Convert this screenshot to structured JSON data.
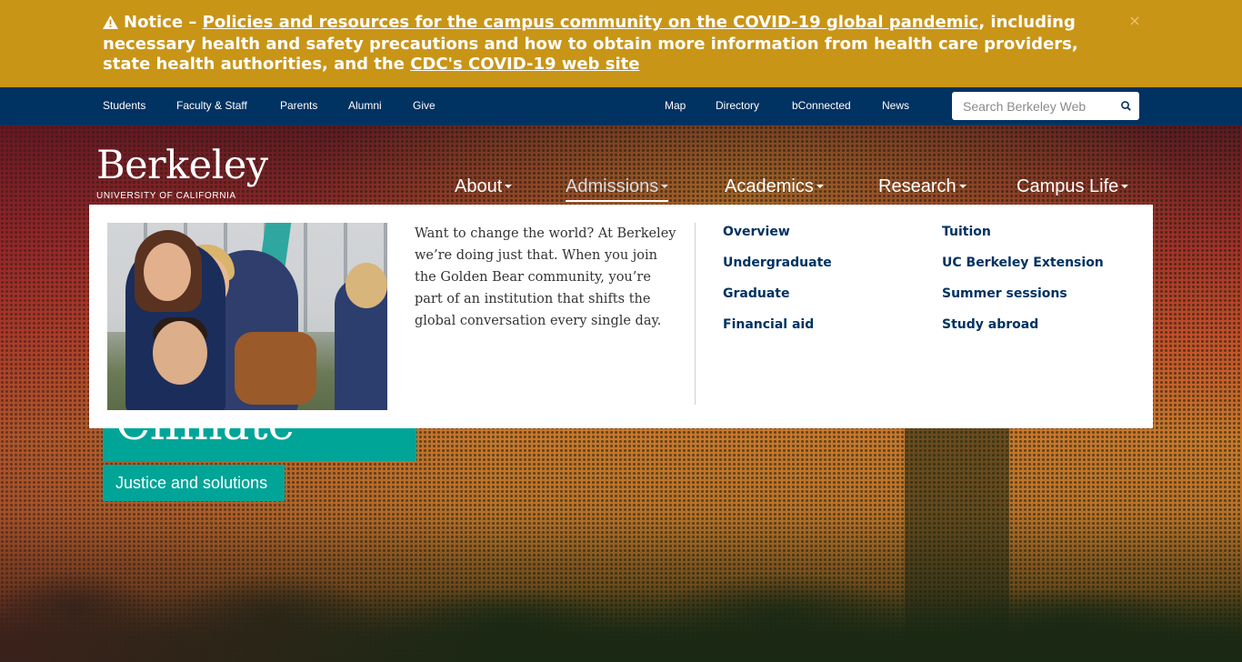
{
  "notice": {
    "prefix": "Notice –",
    "link1": "Policies and resources for the campus community on the COVID-19 global pandemic",
    "middle": ", including necessary health and safety precautions and how to obtain more information from health care providers, state health authorities, and the",
    "link2": "CDC's COVID-19 web site",
    "close": "×",
    "icon": "warning-icon",
    "background": "#c99517"
  },
  "utility_nav": {
    "left": [
      "Students",
      "Faculty & Staff",
      "Parents",
      "Alumni",
      "Give"
    ],
    "right": [
      "Map",
      "Directory",
      "bConnected",
      "News"
    ],
    "search_placeholder": "Search Berkeley Web",
    "background": "#003262"
  },
  "logo": {
    "wordmark": "Berkeley",
    "subtitle": "UNIVERSITY OF CALIFORNIA"
  },
  "main_nav": [
    {
      "label": "About",
      "active": false
    },
    {
      "label": "Admissions",
      "active": true
    },
    {
      "label": "Academics",
      "active": false
    },
    {
      "label": "Research",
      "active": false
    },
    {
      "label": "Campus Life",
      "active": false
    }
  ],
  "dropdown": {
    "blurb": "Want to change the world? At Berkeley we’re doing just that. When you join the Golden Bear community, you’re part of an institution that shifts the global conversation every single day.",
    "links_col1": [
      "Overview",
      "Undergraduate",
      "Graduate",
      "Financial aid"
    ],
    "links_col2": [
      "Tuition",
      "UC Berkeley Extension",
      "Summer sessions",
      "Study abroad"
    ]
  },
  "hero": {
    "headline": "Climate crisis",
    "subhead": "Justice and solutions",
    "accent": "#00a598"
  }
}
